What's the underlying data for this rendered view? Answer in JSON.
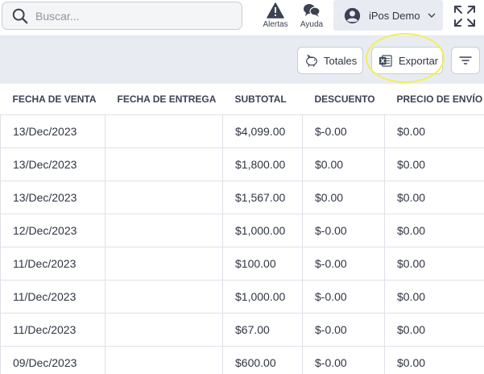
{
  "header": {
    "search": {
      "placeholder": "Buscar..."
    },
    "alerts_label": "Alertas",
    "help_label": "Ayuda",
    "user_name": "iPos Demo"
  },
  "toolbar": {
    "totals_label": "Totales",
    "export_label": "Exportar"
  },
  "table": {
    "columns": [
      "FECHA DE VENTA",
      "FECHA DE ENTREGA",
      "SUBTOTAL",
      "DESCUENTO",
      "PRECIO DE ENVÍO"
    ],
    "rows": [
      [
        "13/Dec/2023",
        "",
        "$4,099.00",
        "$-0.00",
        "$0.00"
      ],
      [
        "13/Dec/2023",
        "",
        "$1,800.00",
        "$0.00",
        "$0.00"
      ],
      [
        "13/Dec/2023",
        "",
        "$1,567.00",
        "$0.00",
        "$0.00"
      ],
      [
        "12/Dec/2023",
        "",
        "$1,000.00",
        "$-0.00",
        "$0.00"
      ],
      [
        "11/Dec/2023",
        "",
        "$100.00",
        "$-0.00",
        "$0.00"
      ],
      [
        "11/Dec/2023",
        "",
        "$1,000.00",
        "$-0.00",
        "$0.00"
      ],
      [
        "11/Dec/2023",
        "",
        "$67.00",
        "$-0.00",
        "$0.00"
      ],
      [
        "09/Dec/2023",
        "",
        "$600.00",
        "$-0.00",
        "$0.00"
      ]
    ]
  },
  "colors": {
    "background": "#e8ecf2",
    "highlight": "#f5ee53",
    "text": "#2f3542",
    "excel_green": "#2f7d4f"
  },
  "icons": [
    "search-icon",
    "alert-icon",
    "help-chat-icon",
    "user-avatar-icon",
    "chevron-down-icon",
    "expand-icon",
    "piggy-bank-icon",
    "excel-icon",
    "filter-icon"
  ]
}
